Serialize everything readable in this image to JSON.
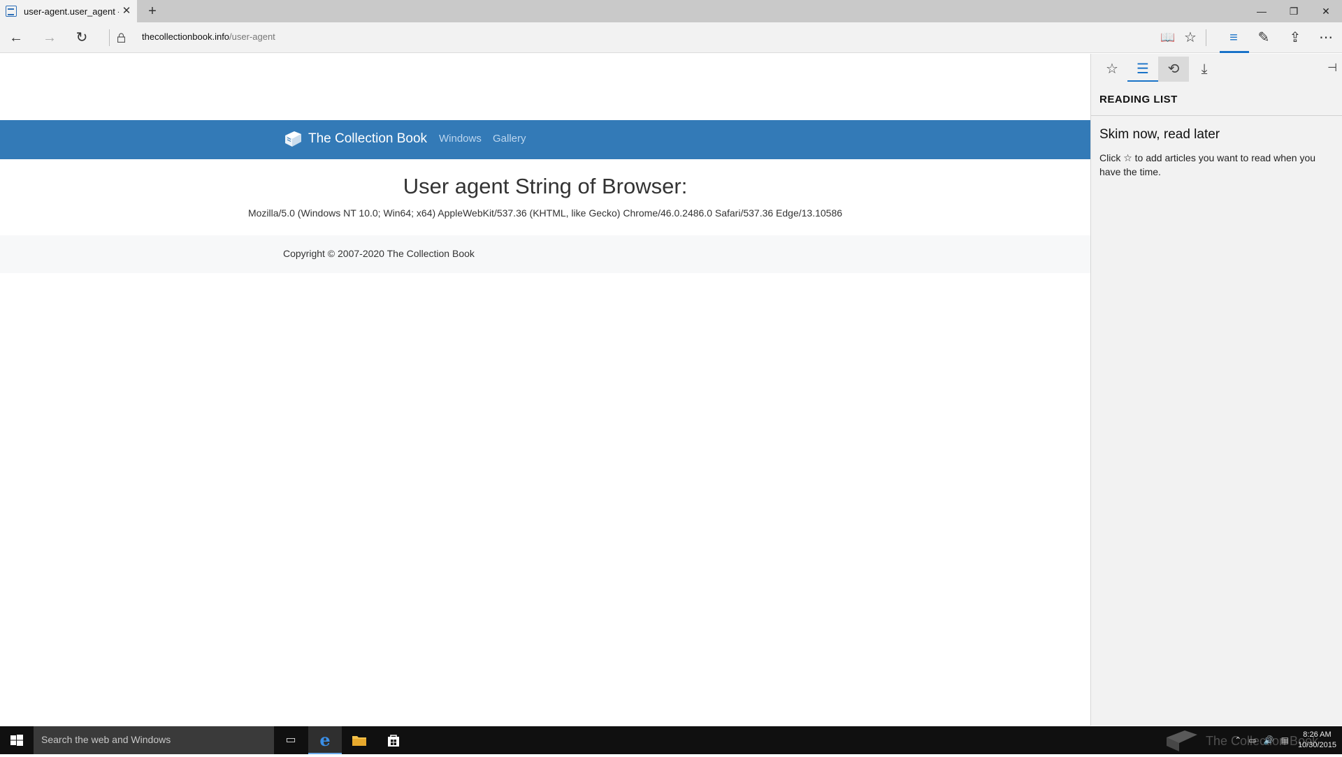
{
  "browser": {
    "tab_title": "user-agent.user_agent -",
    "tab_close": "✕",
    "new_tab": "+",
    "window_controls": {
      "minimize": "—",
      "maximize": "❐",
      "close": "✕"
    },
    "url_host": "thecollectionbook.info",
    "url_path": "/user-agent",
    "nav": {
      "back": "←",
      "forward": "→",
      "refresh": "↻"
    },
    "toolbar_icons": {
      "reading_view": "📖",
      "favorite": "☆",
      "hub": "≡",
      "web_note": "✎",
      "share": "⇪",
      "more": "⋯"
    }
  },
  "site": {
    "brand": "The Collection Book",
    "nav_links": [
      "Windows",
      "Gallery"
    ],
    "headline": "User agent String of Browser:",
    "user_agent": "Mozilla/5.0 (Windows NT 10.0; Win64; x64) AppleWebKit/537.36 (KHTML, like Gecko) Chrome/46.0.2486.0 Safari/537.36 Edge/13.10586",
    "copyright": "Copyright © 2007-2020 The Collection Book"
  },
  "hub": {
    "icons": {
      "favorites": "☆",
      "reading_list": "☰",
      "history": "⟲",
      "downloads": "⤓",
      "pin": "⊣"
    },
    "title": "READING LIST",
    "heading": "Skim now, read later",
    "body": "Click ☆ to add articles you want to read when you have the time."
  },
  "taskbar": {
    "search_placeholder": "Search the web and Windows",
    "watermark": "The Collection Book",
    "clock_time": "8:26 AM",
    "clock_date": "10/30/2015",
    "accent": "#337ab7"
  }
}
